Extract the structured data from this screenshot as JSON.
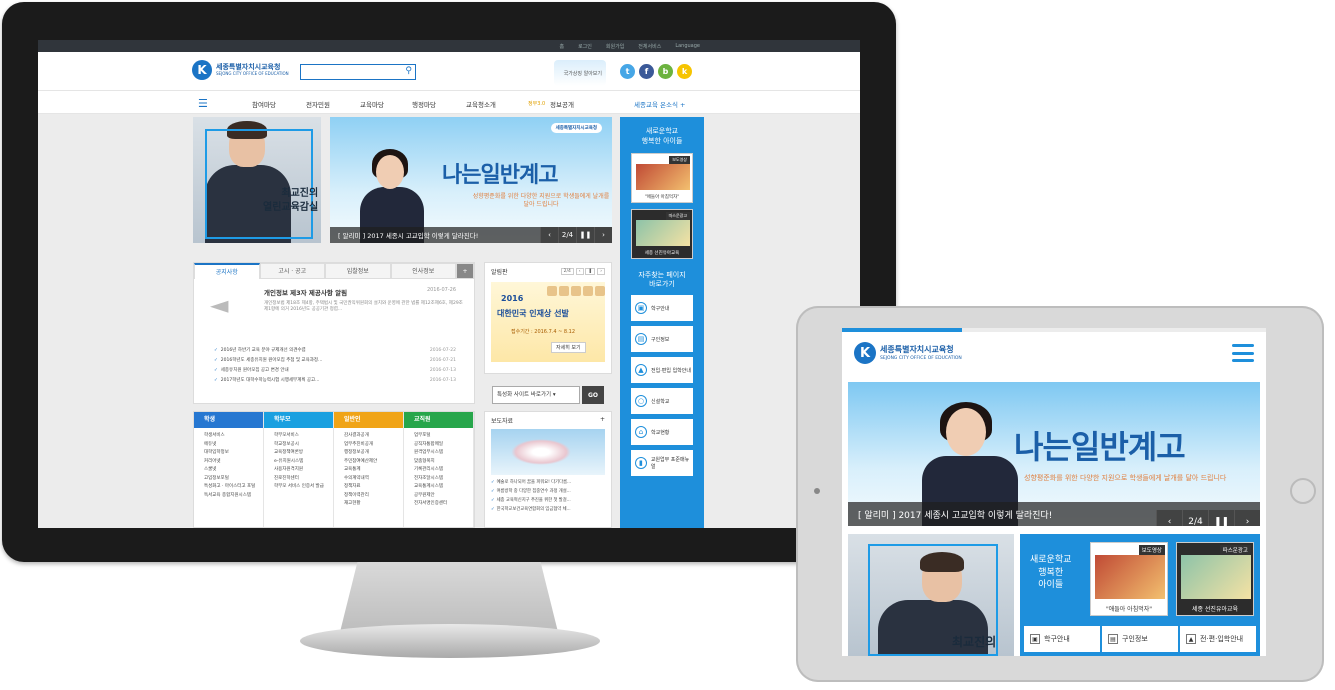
{
  "site": {
    "org_name": "세종특별자치시교육청",
    "org_sub": "SEJONG CITY OFFICE OF EDUCATION",
    "util_links": [
      "홈",
      "로그인",
      "회원가입",
      "전체서비스",
      "Language"
    ],
    "promo_text": "국가상징 알아보기",
    "socials": [
      "t",
      "f",
      "b",
      "k"
    ],
    "nav": [
      "참여마당",
      "전자민원",
      "교육마당",
      "행정마당",
      "교육청소개",
      "정부3.0",
      "정보공개",
      "세종교육 온소식 +"
    ]
  },
  "colors": {
    "brand": "#1b74c5",
    "sidebar": "#1e8fdb",
    "students": "#2677d1",
    "parents": "#1aa0e0",
    "public": "#f0a417",
    "staff": "#27a64b"
  },
  "intro": {
    "caption_line1": "최교진의",
    "caption_line2": "열린교육감실"
  },
  "main_slider": {
    "slogan": "나는일반계고",
    "sub": "성향평준화를 위한 다양한 지원으로 학생들에게 날개를 달아 드립니다",
    "caption": "[ 알리미 ] 2017 세종시 고교입학 이렇게 달라진다!",
    "counter": "2/4",
    "badge": "세종특별자치시교육청"
  },
  "sidebar": {
    "title1": "새로운학교",
    "title2": "행복한 아이들",
    "card1_tag": "보도영상",
    "card1_cap": "\"애들아 아침먹자\"",
    "card2_tag": "따스운광고",
    "card2_cap": "세종 선진유아교육",
    "sub1": "자주찾는 페이지",
    "sub2": "바로가기",
    "links": [
      "학구안내",
      "구인정보",
      "전입·편입 입학안내",
      "신설학교",
      "학교현황",
      "교원업무 포준매뉴얼"
    ]
  },
  "notice": {
    "tabs": [
      "공지사항",
      "고시 · 공고",
      "입찰정보",
      "인사정보",
      "+"
    ],
    "main_title": "개인정보 제3자 제공사항 알림",
    "main_date": "2016-07-26",
    "main_desc": "개인정보법 제18조 제4항, 주택법시 및 국민권익위원회의 설치와 운영에 관한 법률 제12조제6호, 제29조제1항에 의거 2016년도 공공기관 청렴...",
    "items": [
      {
        "t": "2016년 하반기 교육 분야 규제개선 의견수렴",
        "d": "2016-07-22"
      },
      {
        "t": "2016학년도 세종유치원 원아모집 추첨 및 교육과정...",
        "d": "2016-07-21"
      },
      {
        "t": "세종유치원 원아모집 공고 변경 안내",
        "d": "2016-07-13"
      },
      {
        "t": "2017학년도 대학수학능력시험 시행세부계획 공고...",
        "d": "2016-07-13"
      }
    ]
  },
  "alim": {
    "title": "알림판",
    "counter": "2/4",
    "year": "2016",
    "banner_title": "대한민국 인재상 선발",
    "period": "접수기간 : 2016.7.4 ~ 8.12",
    "button": "자세히 보기"
  },
  "goto": {
    "select": "특성화 사이트 바로가기",
    "button": "GO"
  },
  "categories": [
    {
      "title": "학생",
      "items": [
        "학생서비스",
        "에듀넷",
        "대학입학정보",
        "커리어넷",
        "스쿨넷",
        "고입정보포털",
        "특성화고 · 마이스터고 포털",
        "독서교육 종합지원시스템"
      ]
    },
    {
      "title": "학부모",
      "items": [
        "학부모서비스",
        "학교정보공시",
        "교육정책여론방",
        "e-유치원시스템",
        "사용자원격지원",
        "진로진학센터",
        "학부모 서비스 인증서 발급"
      ]
    },
    {
      "title": "일반인",
      "items": [
        "감사결과공개",
        "업무추진비공개",
        "행정정보공개",
        "주민참여예산제안",
        "교육통계",
        "수의계약내역",
        "정책자료",
        "정책이력관리",
        "재고현황"
      ]
    },
    {
      "title": "교직원",
      "items": [
        "업무포털",
        "공직자통합메일",
        "원격업무시스템",
        "맞춤형복지",
        "기록관리시스템",
        "전자조달시스템",
        "교육통계시스템",
        "공무원제안",
        "전자서명인증센터"
      ]
    }
  ],
  "press": {
    "title": "보도자료",
    "items": [
      "예술로 하나되어 꿈을 피워요! 다기다름...",
      "여름방학 중 다양한 집중연수 과정 개설...",
      "세종 교육혁신지구 추진을 위한 첫 발걸...",
      "한국학교보건교육연합회의 임금협약 체..."
    ]
  },
  "tablet": {
    "sidebar_title1": "새로운학교",
    "sidebar_title2": "행복한",
    "sidebar_title3": "아이들",
    "links": [
      "학구안내",
      "구인정보",
      "전·편·입학안내"
    ],
    "counter": "2/4"
  }
}
